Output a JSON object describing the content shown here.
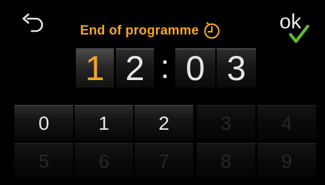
{
  "header": {
    "title": "End of programme",
    "title_icon": "clock-icon",
    "back_icon": "back-arrow-icon",
    "ok_label": "ok",
    "ok_icon": "checkmark-icon"
  },
  "time": {
    "digits": [
      "1",
      "2",
      "0",
      "3"
    ],
    "separator": ":",
    "active_index": 0
  },
  "keypad": {
    "keys": [
      {
        "label": "0",
        "enabled": true
      },
      {
        "label": "1",
        "enabled": true
      },
      {
        "label": "2",
        "enabled": true
      },
      {
        "label": "3",
        "enabled": false
      },
      {
        "label": "4",
        "enabled": false
      },
      {
        "label": "5",
        "enabled": false
      },
      {
        "label": "6",
        "enabled": false
      },
      {
        "label": "7",
        "enabled": false
      },
      {
        "label": "8",
        "enabled": false
      },
      {
        "label": "9",
        "enabled": false
      }
    ]
  },
  "colors": {
    "accent": "#f5a623",
    "check": "#5cb82e",
    "background": "#000000",
    "text": "#e6e6e6"
  }
}
